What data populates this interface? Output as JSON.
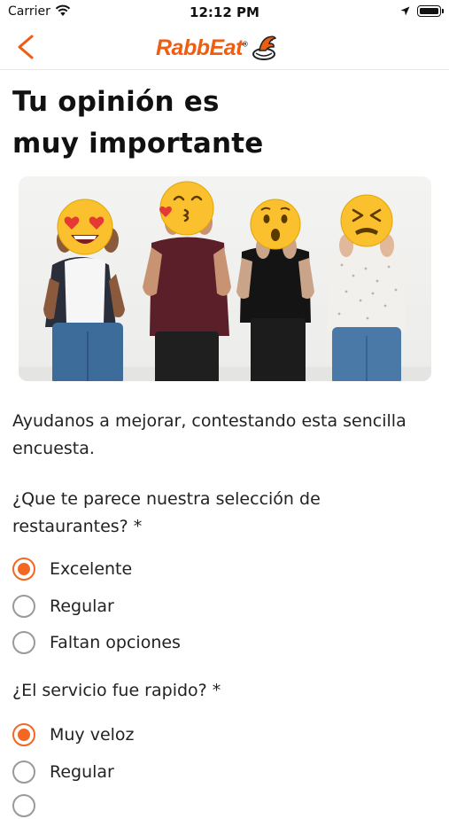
{
  "status_bar": {
    "carrier": "Carrier",
    "time": "12:12 PM"
  },
  "nav": {
    "logo": "RabbEat",
    "logo_mark": "®"
  },
  "page": {
    "title_line1": "Tu opinión es",
    "title_line2": "muy importante",
    "intro": "Ayudanos a mejorar, contestando esta sencilla encuesta."
  },
  "questions": [
    {
      "text": "¿Que te parece nuestra selección de restaurantes? *",
      "options": [
        "Excelente",
        "Regular",
        "Faltan opciones"
      ],
      "selected": "Excelente"
    },
    {
      "text": "¿El servicio fue rapido? *",
      "options": [
        "Muy veloz",
        "Regular"
      ],
      "selected": "Muy veloz"
    }
  ],
  "colors": {
    "accent": "#f26822",
    "brand": "#ee5e12",
    "radio_border": "#9a9a9a"
  },
  "icons": [
    "wifi-icon",
    "location-icon",
    "battery-icon",
    "back-chevron-icon",
    "rabbeat-logo-icon"
  ]
}
